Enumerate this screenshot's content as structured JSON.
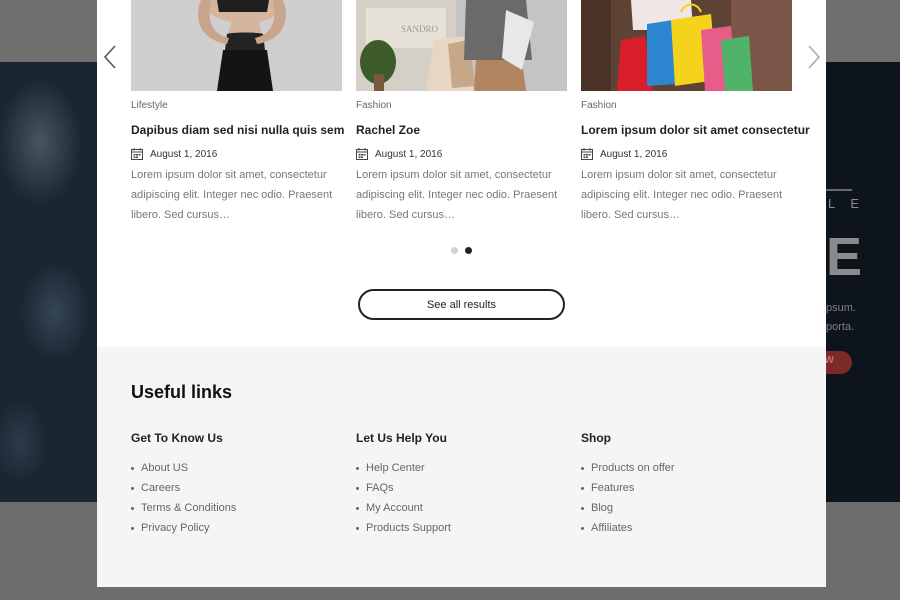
{
  "hero_fragments": {
    "letters_le": "L E",
    "big_letter": "E",
    "paragraph_line_1": "psum.",
    "paragraph_line_2": "porta.",
    "button_fragment": "W"
  },
  "carousel": {
    "prev_icon": "chevron-left-icon",
    "next_icon": "chevron-right-icon",
    "cards": [
      {
        "category": "Lifestyle",
        "title": "Dapibus diam sed nisi nulla quis sem",
        "date": "August 1, 2016",
        "excerpt": "Lorem ipsum dolor sit amet, consectetur adipiscing elit. Integer nec odio. Praesent libero. Sed cursus…",
        "image": "fitness-woman-photo"
      },
      {
        "category": "Fashion",
        "title": "Rachel Zoe",
        "date": "August 1, 2016",
        "excerpt": "Lorem ipsum dolor sit amet, consectetur adipiscing elit. Integer nec odio. Praesent libero. Sed cursus…",
        "image": "shopping-mall-photo"
      },
      {
        "category": "Fashion",
        "title": "Lorem ipsum dolor sit amet consectetur",
        "date": "August 1, 2016",
        "excerpt": "Lorem ipsum dolor sit amet, consectetur adipiscing elit. Integer nec odio. Praesent libero. Sed cursus…",
        "image": "shopping-bags-photo"
      }
    ],
    "dots": {
      "count": 2,
      "active_index": 2
    },
    "see_all_label": "See all results"
  },
  "useful_links": {
    "title": "Useful links",
    "columns": [
      {
        "heading": "Get To Know Us",
        "items": [
          "About US",
          "Careers",
          "Terms & Conditions",
          "Privacy Policy"
        ]
      },
      {
        "heading": "Let Us Help You",
        "items": [
          "Help Center",
          "FAQs",
          "My Account",
          "Products Support"
        ]
      },
      {
        "heading": "Shop",
        "items": [
          "Products on offer",
          "Features",
          "Blog",
          "Affiliates"
        ]
      }
    ]
  },
  "colors": {
    "panel_bg": "#ffffff",
    "links_bg": "#f5f5f5",
    "text_dark": "#222222",
    "text_muted": "#777777",
    "overlay": "#6e6e6e"
  }
}
